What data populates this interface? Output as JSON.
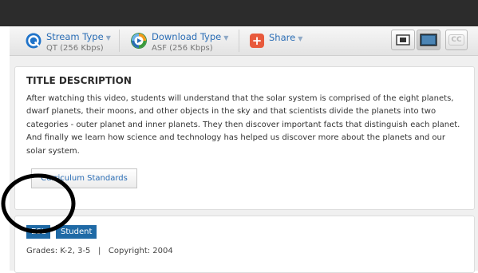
{
  "toolbar": {
    "stream": {
      "label": "Stream Type",
      "value": "QT (256 Kbps)",
      "icon": "quicktime-icon"
    },
    "download": {
      "label": "Download Type",
      "value": "ASF (256 Kbps)",
      "icon": "media-player-icon"
    },
    "share": {
      "label": "Share",
      "icon": "plus-icon"
    },
    "views": [
      {
        "name": "fullscreen-view-button",
        "icon": "fullscreen-icon",
        "active": false
      },
      {
        "name": "standard-view-button",
        "icon": "screen-icon",
        "active": true
      },
      {
        "name": "cc-button",
        "label": "CC",
        "active": false
      }
    ],
    "caret": "▼"
  },
  "description": {
    "title": "TITLE DESCRIPTION",
    "text": "After watching this video, students will understand that the solar system is comprised of the eight planets, dwarf planets, their moons, and other objects in the sky and that scientists divide the planets into two categories - outer planet and inner planets. They then discover important facts that distinguish each planet. And finally we learn how science and technology has helped us discover more about the planets and our solar system.",
    "standards_button": "Curriculum Standards"
  },
  "meta": {
    "tags": [
      "ESL",
      "Student"
    ],
    "grades_label": "Grades: K-2, 3-5",
    "separator": "|",
    "copyright": "Copyright: 2004"
  },
  "colors": {
    "accent": "#2a6db5",
    "tag_bg": "#1f6aa6",
    "share_icon": "#e85a3c",
    "topbar": "#2c2c2c"
  }
}
